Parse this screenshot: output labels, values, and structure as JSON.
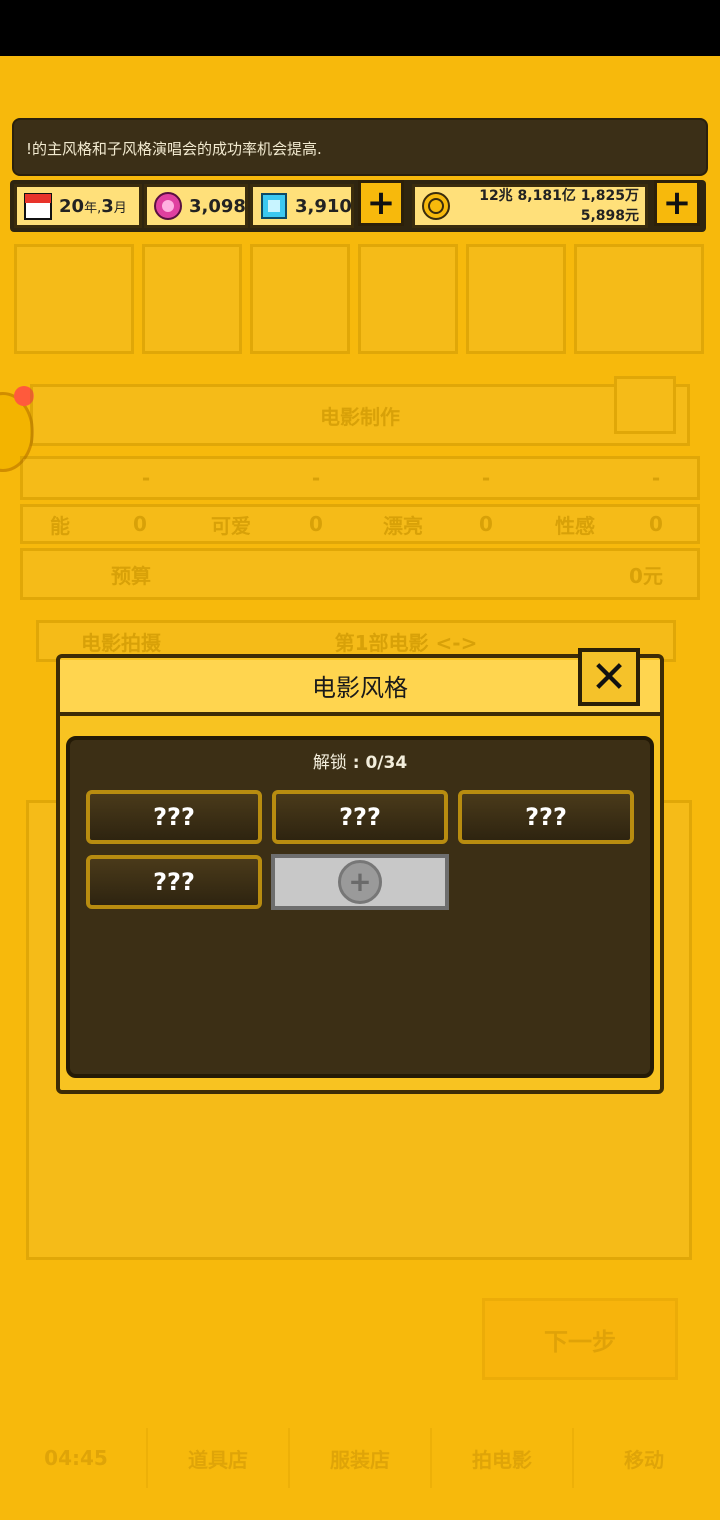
{
  "ticker": {
    "text": "!的主风格和子风格演唱会的成功率机会提高."
  },
  "resources": {
    "date_year": "20",
    "date_year_unit": "年,",
    "date_month": "3",
    "date_month_unit": "月",
    "pink_gems": "3,098",
    "blue_gems": "3,910",
    "money_line1": "12兆 8,181亿 1,825万",
    "money_line2": "5,898元",
    "plus_symbol": "+"
  },
  "background_panel": {
    "title": "电影制作",
    "stats": [
      {
        "label": "能",
        "value": "0"
      },
      {
        "label": "可爱",
        "value": "0"
      },
      {
        "label": "漂亮",
        "value": "0"
      },
      {
        "label": "性感",
        "value": "0"
      }
    ],
    "dash": "-",
    "budget_label": "预算",
    "budget_value": "0元",
    "shoot_label": "电影拍摄",
    "movie_label": "第1部电影 <->",
    "next_button": "下一步"
  },
  "bottom_nav": {
    "time": "04:45",
    "items": [
      "道具店",
      "服装店",
      "拍电影",
      "移动"
    ]
  },
  "dialog": {
    "title": "电影风格",
    "close_symbol": "✕",
    "unlock_label": "解锁",
    "unlock_sep": " : ",
    "unlock_value": "0/34",
    "slots": [
      "???",
      "???",
      "???",
      "???"
    ],
    "add_symbol": "+"
  },
  "colors": {
    "background": "#F7B90C",
    "dialog_inner": "#3c2f15",
    "slot_border": "#b88c10"
  }
}
